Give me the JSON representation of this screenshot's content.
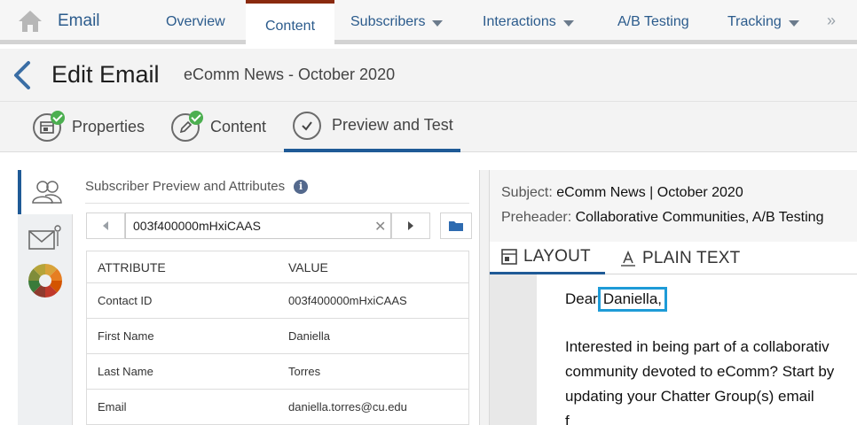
{
  "topnav": {
    "app_name": "Email",
    "tabs": [
      {
        "label": "Overview",
        "dropdown": false
      },
      {
        "label": "Content",
        "dropdown": false,
        "active": true
      },
      {
        "label": "Subscribers",
        "dropdown": true
      },
      {
        "label": "Interactions",
        "dropdown": true
      },
      {
        "label": "A/B Testing",
        "dropdown": false
      },
      {
        "label": "Tracking",
        "dropdown": true
      }
    ],
    "more": "»"
  },
  "header": {
    "title": "Edit Email",
    "subtitle": "eComm News - October 2020"
  },
  "steps": [
    {
      "label": "Properties",
      "complete": true
    },
    {
      "label": "Content",
      "complete": true
    },
    {
      "label": "Preview and Test",
      "active": true
    }
  ],
  "subscriber_panel": {
    "title": "Subscriber Preview and Attributes",
    "search_value": "003f400000mHxiCAAS",
    "table": {
      "headers": [
        "ATTRIBUTE",
        "VALUE"
      ],
      "rows": [
        {
          "attribute": "Contact ID",
          "value": "003f400000mHxiCAAS"
        },
        {
          "attribute": "First Name",
          "value": "Daniella"
        },
        {
          "attribute": "Last Name",
          "value": "Torres"
        },
        {
          "attribute": "Email",
          "value": "daniella.torres@cu.edu"
        }
      ]
    }
  },
  "preview": {
    "subject_label": "Subject:",
    "subject_value": "eComm News | October 2020",
    "preheader_label": "Preheader:",
    "preheader_value": "Collaborative Communities, A/B Testing",
    "view_tabs": [
      "LAYOUT",
      "PLAIN TEXT"
    ],
    "greeting_prefix": "Dear",
    "greeting_name": "Daniella,",
    "body_lines": [
      "Interested in being part of a collaborativ",
      "community devoted to eComm? Start by",
      "updating your Chatter Group(s) email",
      "f                                      "
    ]
  },
  "colors": {
    "accent": "#1f5a96",
    "active_tab_top": "#8a2a0f",
    "highlight": "#1e9bd7",
    "check": "#4caf50"
  }
}
